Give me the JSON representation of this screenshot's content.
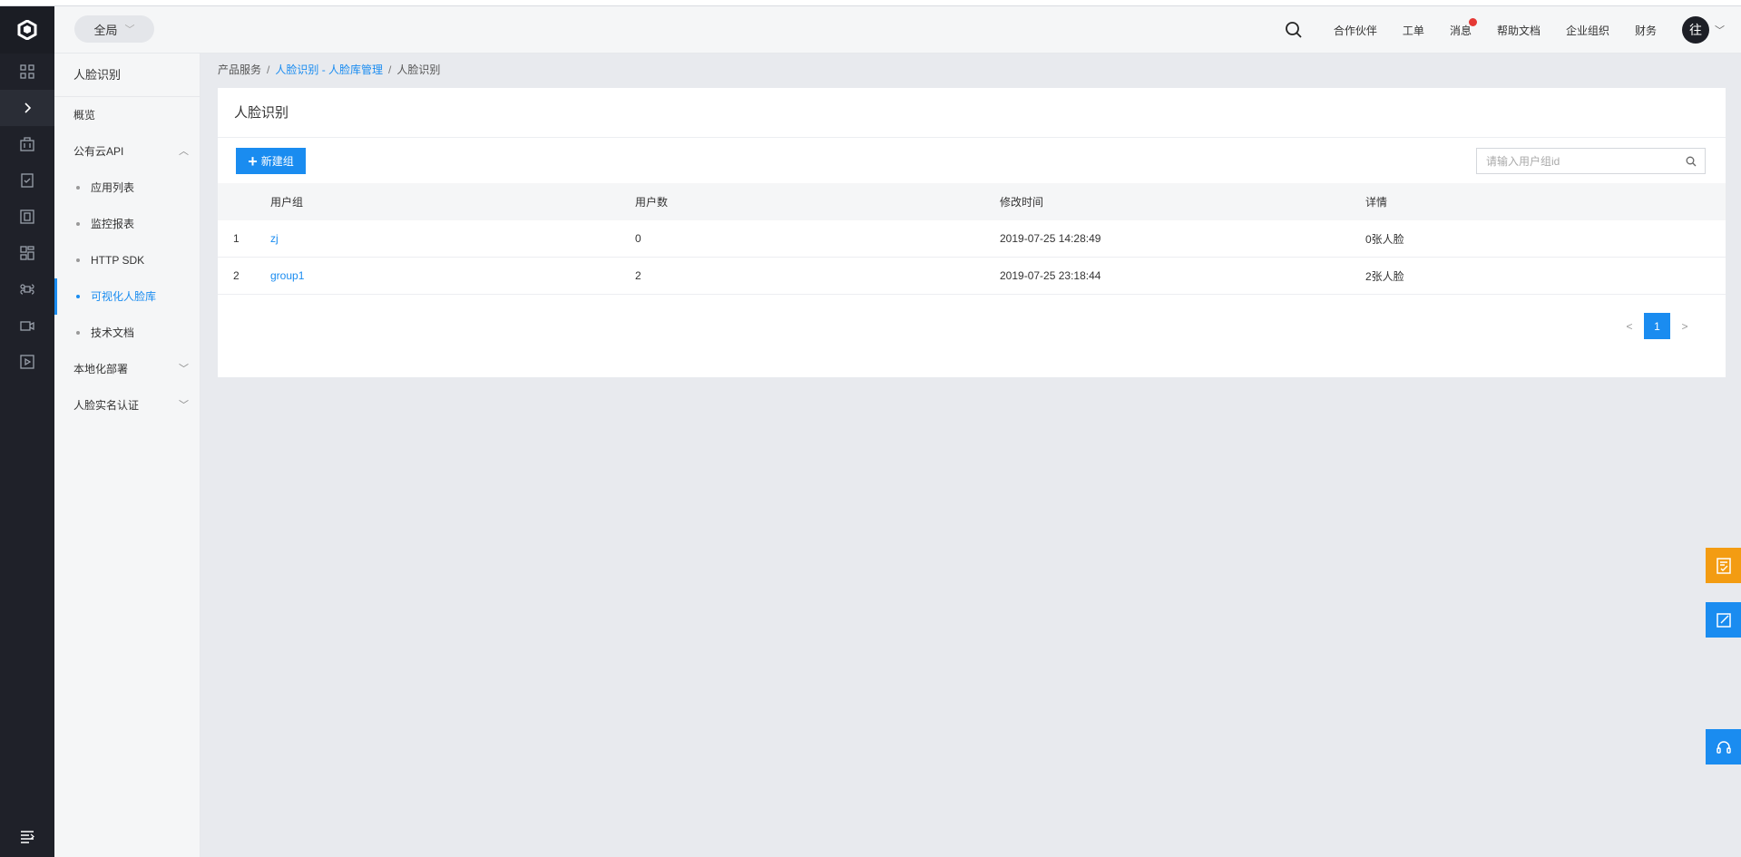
{
  "header": {
    "scope_label": "全局",
    "links": [
      {
        "label": "合作伙伴"
      },
      {
        "label": "工单"
      },
      {
        "label": "消息",
        "has_dot": true
      },
      {
        "label": "帮助文档"
      },
      {
        "label": "企业组织"
      },
      {
        "label": "财务"
      }
    ],
    "avatar_text": "往"
  },
  "rail": {
    "icons": [
      "dashboard-icon",
      "expand-arrow-icon",
      "briefcase-icon",
      "document-check-icon",
      "document-grid-icon",
      "modules-icon",
      "command-icon",
      "video-camera-icon",
      "play-box-icon"
    ],
    "bottom_icon": "menu-list-icon"
  },
  "sidenav": {
    "title": "人脸识别",
    "items": {
      "overview": "概览",
      "public_api": "公有云API",
      "sub": [
        "应用列表",
        "监控报表",
        "HTTP SDK",
        "可视化人脸库",
        "技术文档"
      ],
      "local_deploy": "本地化部署",
      "realname": "人脸实名认证"
    }
  },
  "breadcrumb": {
    "root": "产品服务",
    "middle": "人脸识别 - 人脸库管理",
    "current": "人脸识别"
  },
  "card": {
    "title": "人脸识别",
    "new_button": "新建组",
    "search_placeholder": "请输入用户组id"
  },
  "table": {
    "headers": [
      "",
      "用户组",
      "用户数",
      "修改时间",
      "详情"
    ],
    "rows": [
      {
        "index": "1",
        "group": "zj",
        "users": "0",
        "modified": "2019-07-25 14:28:49",
        "detail": "0张人脸"
      },
      {
        "index": "2",
        "group": "group1",
        "users": "2",
        "modified": "2019-07-25 23:18:44",
        "detail": "2张人脸"
      }
    ]
  },
  "pagination": {
    "prev": "<",
    "current": "1",
    "next": ">"
  },
  "colors": {
    "accent": "#1a8cf0",
    "rail_bg": "#1f2129",
    "float_orange": "#f39c12",
    "float_blue": "#1a8cf0"
  }
}
